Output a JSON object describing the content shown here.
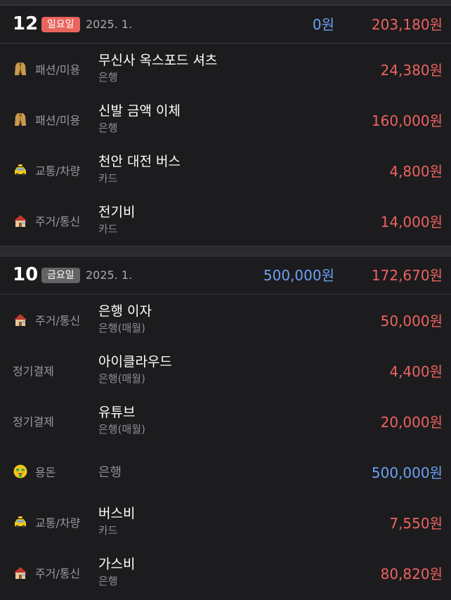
{
  "groups": [
    {
      "day": "12",
      "weekday": "일요일",
      "month": "2025. 1.",
      "income": "0원",
      "expense": "203,180원",
      "rows": [
        {
          "icon": "coat-icon",
          "category": "패션/미용",
          "title": "무신사 옥스포드 셔츠",
          "sub": "은행",
          "amount": "24,380원"
        },
        {
          "icon": "coat-icon",
          "category": "패션/미용",
          "title": "신발 금액 이체",
          "sub": "은행",
          "amount": "160,000원"
        },
        {
          "icon": "taxi-icon",
          "category": "교통/차량",
          "title": "천안 대전 버스",
          "sub": "카드",
          "amount": "4,800원"
        },
        {
          "icon": "house-icon",
          "category": "주거/통신",
          "title": "전기비",
          "sub": "카드",
          "amount": "14,000원"
        }
      ]
    },
    {
      "day": "10",
      "weekday": "금요일",
      "month": "2025. 1.",
      "income": "500,000원",
      "expense": "172,670원",
      "rows": [
        {
          "icon": "house-icon",
          "category": "주거/통신",
          "title": "은행 이자",
          "sub": "은행(매월)",
          "amount": "50,000원"
        },
        {
          "icon": "",
          "category": "정기결제",
          "title": "아이클라우드",
          "sub": "은행(매월)",
          "amount": "4,400원"
        },
        {
          "icon": "",
          "category": "정기결제",
          "title": "유튜브",
          "sub": "은행(매월)",
          "amount": "20,000원"
        },
        {
          "icon": "money-face-icon",
          "category": "용돈",
          "title": "",
          "sub": "은행",
          "amount": "500,000원"
        },
        {
          "icon": "taxi-icon",
          "category": "교통/차량",
          "title": "버스비",
          "sub": "카드",
          "amount": "7,550원"
        },
        {
          "icon": "house-icon",
          "category": "주거/통신",
          "title": "가스비",
          "sub": "은행",
          "amount": "80,820원"
        }
      ]
    }
  ],
  "colors": {
    "expense": "#ee6360",
    "income": "#6e9ff4",
    "sunday_badge": "#e8655d",
    "weekday_badge": "#636366"
  }
}
